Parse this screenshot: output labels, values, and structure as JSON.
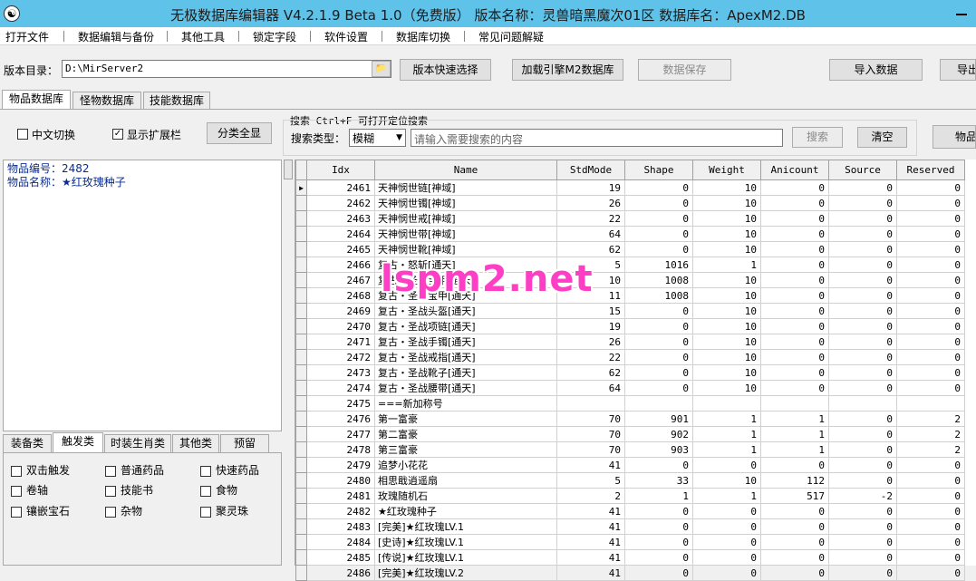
{
  "window": {
    "title": "无极数据库编辑器 V4.2.1.9   Beta 1.0（免费版）    版本名称：灵兽暗黑魔次01区     数据库名：ApexM2.DB"
  },
  "menu": [
    "打开文件",
    "数据编辑与备份",
    "其他工具",
    "锁定字段",
    "软件设置",
    "数据库切换",
    "常见问题解疑"
  ],
  "toolbar": {
    "dir_label": "版本目录：",
    "dir_value": "D:\\MirServer2",
    "quick_select": "版本快速选择",
    "load_engine": "加载引擎M2数据库",
    "save_data": "数据保存",
    "import_data": "导入数据",
    "export_data": "导出"
  },
  "tabs": [
    "物品数据库",
    "怪物数据库",
    "技能数据库"
  ],
  "options": {
    "chinese_switch": "中文切换",
    "chinese_switch_checked": false,
    "show_ext": "显示扩展栏",
    "show_ext_checked": true,
    "show_all_categories": "分类全显"
  },
  "search": {
    "title": "搜索  Ctrl+F 可打开定位搜索",
    "type_label": "搜索类型：",
    "type_value": "模糊",
    "placeholder": "请输入需要搜索的内容",
    "search_button": "搜索",
    "clear_button": "清空",
    "right_button": "物品"
  },
  "info": {
    "id_line": "物品编号：2482",
    "name_line": "物品名称：★红玫瑰种子"
  },
  "category_tabs": [
    "装备类",
    "触发类",
    "时装生肖类",
    "其他类",
    "预留"
  ],
  "categories": [
    {
      "label": "双击触发",
      "checked": false
    },
    {
      "label": "普通药品",
      "checked": false
    },
    {
      "label": "快速药品",
      "checked": false
    },
    {
      "label": "卷轴",
      "checked": false
    },
    {
      "label": "技能书",
      "checked": false
    },
    {
      "label": "食物",
      "checked": false
    },
    {
      "label": "镶嵌宝石",
      "checked": false
    },
    {
      "label": "杂物",
      "checked": false
    },
    {
      "label": "聚灵珠",
      "checked": false
    }
  ],
  "grid": {
    "columns": [
      "Idx",
      "Name",
      "StdMode",
      "Shape",
      "Weight",
      "Anicount",
      "Source",
      "Reserved"
    ],
    "rows": [
      [
        "2461",
        "天神悯世链[神域]",
        "19",
        "0",
        "10",
        "0",
        "0",
        "0"
      ],
      [
        "2462",
        "天神悯世镯[神域]",
        "26",
        "0",
        "10",
        "0",
        "0",
        "0"
      ],
      [
        "2463",
        "天神悯世戒[神域]",
        "22",
        "0",
        "10",
        "0",
        "0",
        "0"
      ],
      [
        "2464",
        "天神悯世带[神域]",
        "64",
        "0",
        "10",
        "0",
        "0",
        "0"
      ],
      [
        "2465",
        "天神悯世靴[神域]",
        "62",
        "0",
        "10",
        "0",
        "0",
        "0"
      ],
      [
        "2466",
        "复古・怒斩[通天]",
        "5",
        "1016",
        "1",
        "0",
        "0",
        "0"
      ],
      [
        "2467",
        "复古・圣战宝甲[通天]",
        "10",
        "1008",
        "10",
        "0",
        "0",
        "0"
      ],
      [
        "2468",
        "复古・圣战宝甲[通天]",
        "11",
        "1008",
        "10",
        "0",
        "0",
        "0"
      ],
      [
        "2469",
        "复古・圣战头盔[通天]",
        "15",
        "0",
        "10",
        "0",
        "0",
        "0"
      ],
      [
        "2470",
        "复古・圣战项链[通天]",
        "19",
        "0",
        "10",
        "0",
        "0",
        "0"
      ],
      [
        "2471",
        "复古・圣战手镯[通天]",
        "26",
        "0",
        "10",
        "0",
        "0",
        "0"
      ],
      [
        "2472",
        "复古・圣战戒指[通天]",
        "22",
        "0",
        "10",
        "0",
        "0",
        "0"
      ],
      [
        "2473",
        "复古・圣战靴子[通天]",
        "62",
        "0",
        "10",
        "0",
        "0",
        "0"
      ],
      [
        "2474",
        "复古・圣战腰带[通天]",
        "64",
        "0",
        "10",
        "0",
        "0",
        "0"
      ],
      [
        "2475",
        "===新加称号",
        "",
        "",
        "",
        "",
        "",
        ""
      ],
      [
        "2476",
        "第一富豪",
        "70",
        "901",
        "1",
        "1",
        "0",
        "2"
      ],
      [
        "2477",
        "第二富豪",
        "70",
        "902",
        "1",
        "1",
        "0",
        "2"
      ],
      [
        "2478",
        "第三富豪",
        "70",
        "903",
        "1",
        "1",
        "0",
        "2"
      ],
      [
        "2479",
        "追梦小花花",
        "41",
        "0",
        "0",
        "0",
        "0",
        "0"
      ],
      [
        "2480",
        "相思戢逍遥扇",
        "5",
        "33",
        "10",
        "112",
        "0",
        "0"
      ],
      [
        "2481",
        "玫瑰随机石",
        "2",
        "1",
        "1",
        "517",
        "-2",
        "0"
      ],
      [
        "2482",
        "★红玫瑰种子",
        "41",
        "0",
        "0",
        "0",
        "0",
        "0"
      ],
      [
        "2483",
        "[完美]★红玫瑰LV.1",
        "41",
        "0",
        "0",
        "0",
        "0",
        "0"
      ],
      [
        "2484",
        "[史诗]★红玫瑰LV.1",
        "41",
        "0",
        "0",
        "0",
        "0",
        "0"
      ],
      [
        "2485",
        "[传说]★红玫瑰LV.1",
        "41",
        "0",
        "0",
        "0",
        "0",
        "0"
      ],
      [
        "2486",
        "[完美]★红玫瑰LV.2",
        "41",
        "0",
        "0",
        "0",
        "0",
        "0"
      ]
    ]
  },
  "watermark": "lspm2.net"
}
